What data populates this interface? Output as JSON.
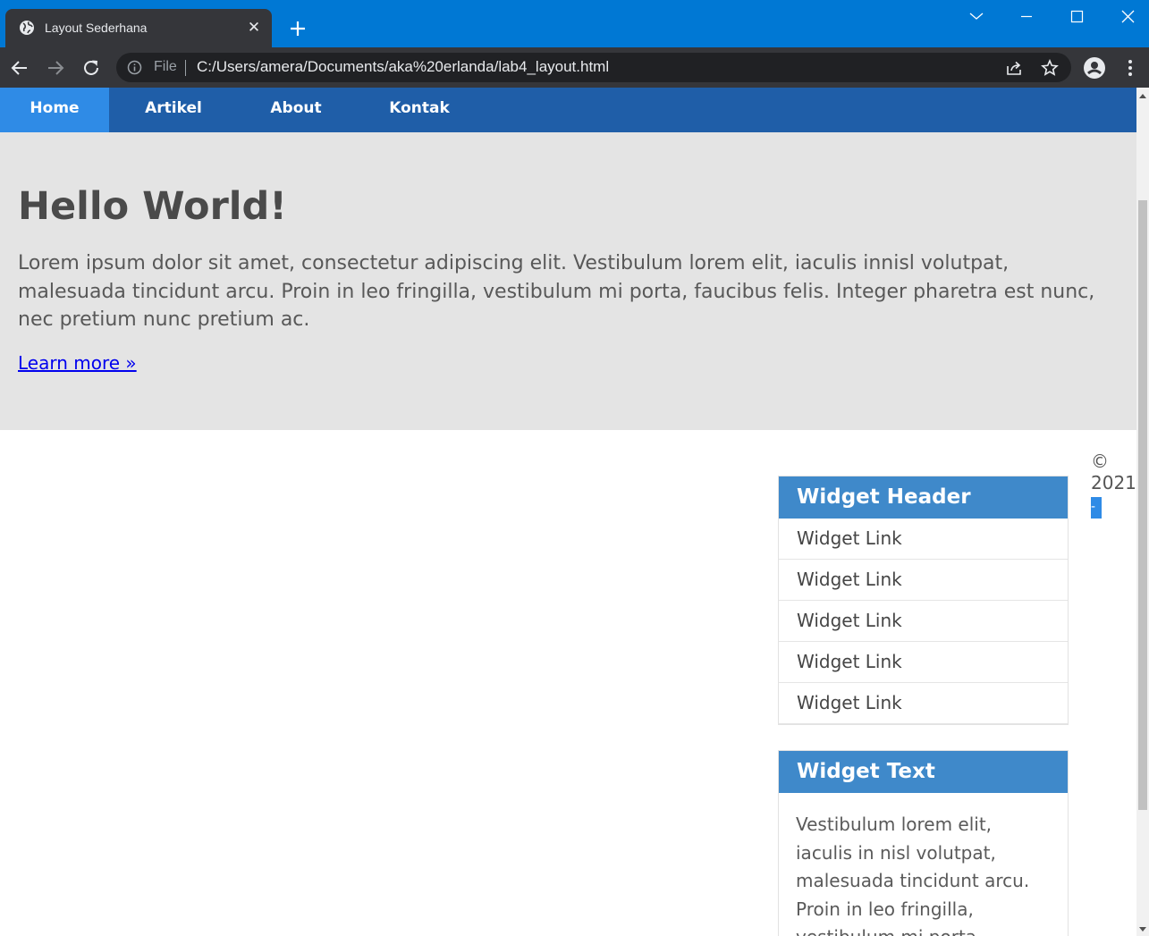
{
  "browser": {
    "tab_title": "Layout Sederhana",
    "tab_close": "✕",
    "address_scheme_label": "File",
    "url": "C:/Users/amera/Documents/aka%20erlanda/lab4_layout.html",
    "theme_color": "#0078d4"
  },
  "nav": {
    "items": [
      {
        "label": "Home",
        "active": true
      },
      {
        "label": "Artikel",
        "active": false
      },
      {
        "label": "About",
        "active": false
      },
      {
        "label": "Kontak",
        "active": false
      }
    ],
    "bg_color": "#1f5ea8",
    "active_color": "#2f8be6"
  },
  "hero": {
    "title": "Hello World!",
    "body": "Lorem ipsum dolor sit amet, consectetur adipiscing elit. Vestibulum lorem elit, iaculis innisl volutpat, malesuada tincidunt arcu. Proin in leo fringilla, vestibulum mi porta, faucibus felis. Integer pharetra est nunc, nec pretium nunc pretium ac.",
    "link": "Learn more »"
  },
  "sidebar": {
    "widget_links": {
      "header": "Widget Header",
      "links": [
        "Widget Link",
        "Widget Link",
        "Widget Link",
        "Widget Link",
        "Widget Link"
      ]
    },
    "widget_text": {
      "header": "Widget Text",
      "body": "Vestibulum lorem elit, iaculis in nisl volutpat, malesuada tincidunt arcu. Proin in leo fringilla, vestibulum mi porta, faucibus felis. Integer"
    },
    "header_color": "#3f89ca"
  },
  "footer": {
    "copy": "© 2021",
    "mark": "-"
  }
}
